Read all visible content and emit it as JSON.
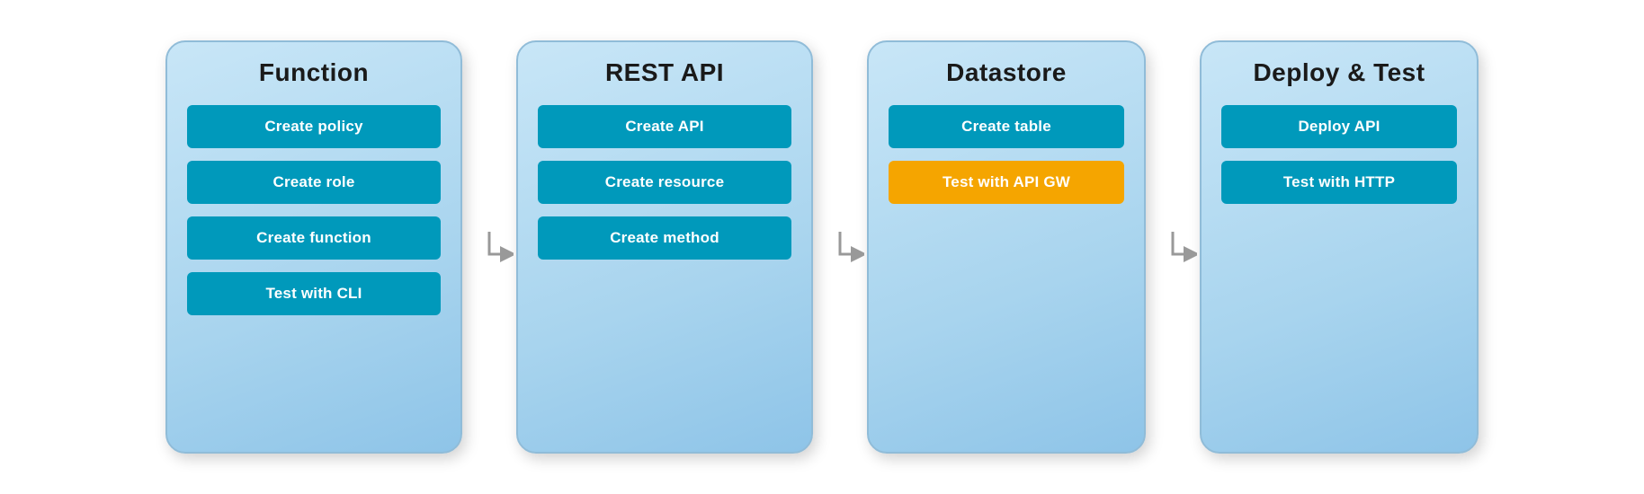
{
  "panels": [
    {
      "id": "function",
      "title": "Function",
      "buttons": [
        {
          "label": "Create policy",
          "style": "teal"
        },
        {
          "label": "Create role",
          "style": "teal"
        },
        {
          "label": "Create function",
          "style": "teal"
        },
        {
          "label": "Test with CLI",
          "style": "teal"
        }
      ]
    },
    {
      "id": "rest-api",
      "title": "REST API",
      "buttons": [
        {
          "label": "Create API",
          "style": "teal"
        },
        {
          "label": "Create resource",
          "style": "teal"
        },
        {
          "label": "Create method",
          "style": "teal"
        }
      ]
    },
    {
      "id": "datastore",
      "title": "Datastore",
      "buttons": [
        {
          "label": "Create table",
          "style": "teal"
        },
        {
          "label": "Test with API GW",
          "style": "orange"
        }
      ]
    },
    {
      "id": "deploy-test",
      "title": "Deploy & Test",
      "buttons": [
        {
          "label": "Deploy API",
          "style": "teal"
        },
        {
          "label": "Test with HTTP",
          "style": "teal"
        }
      ]
    }
  ],
  "arrows": [
    {
      "id": "arrow-1"
    },
    {
      "id": "arrow-2"
    },
    {
      "id": "arrow-3"
    }
  ]
}
